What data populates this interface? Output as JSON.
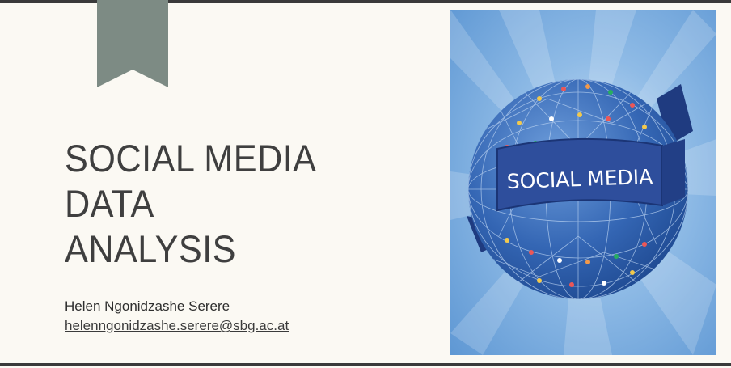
{
  "slide": {
    "title_lines": [
      "SOCIAL MEDIA DATA",
      "ANALYSIS"
    ],
    "author": "Helen Ngonidzashe Serere",
    "email": "helenngonidzashe.serere@sbg.ac.at"
  },
  "illustration": {
    "banner_text": "SOCIAL MEDIA"
  },
  "colors": {
    "background": "#fbf9f3",
    "bookmark": "#7d8b84",
    "title_text": "#3f3f3f",
    "image_background": "#6aa3dc",
    "globe": "#2f65b0",
    "banner": "#2e4e9c"
  }
}
